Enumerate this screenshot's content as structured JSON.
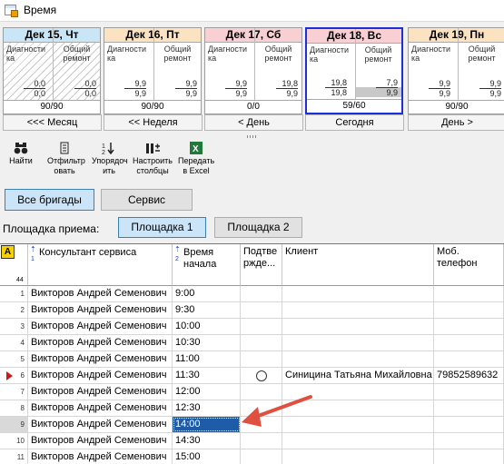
{
  "window": {
    "title": "Время"
  },
  "days": [
    {
      "header": "Дек 15, Чт",
      "color": "#c9e6f7",
      "col1": "Диагности ка",
      "col2": "Общий ремонт",
      "l1": "0,0",
      "l2": "0,0",
      "r1": "0,0",
      "r2": "0,0",
      "footer": "90/90",
      "hatched": true
    },
    {
      "header": "Дек 16, Пт",
      "color": "#fbe3c2",
      "col1": "Диагности ка",
      "col2": "Общий ремонт",
      "l1": "9,9",
      "l2": "9,9",
      "r1": "9,9",
      "r2": "9,9",
      "footer": "90/90",
      "hatched": false
    },
    {
      "header": "Дек 17, Сб",
      "color": "#f8cfd3",
      "col1": "Диагности ка",
      "col2": "Общий ремонт",
      "l1": "9,9",
      "l2": "9,9",
      "r1": "19,8",
      "r2": "9,9",
      "footer": "0/0",
      "hatched": false
    },
    {
      "header": "Дек 18, Вс",
      "color": "#f8cfd3",
      "col1": "Диагности ка",
      "col2": "Общий ремонт",
      "l1": "19,8",
      "l2": "19,8",
      "r1": "7,9",
      "r2": "9,9",
      "footer": "59/60",
      "hatched": false,
      "today": true
    },
    {
      "header": "Дек 19, Пн",
      "color": "#fbe3c2",
      "col1": "Диагности ка",
      "col2": "Общий ремонт",
      "l1": "9,9",
      "l2": "9,9",
      "r1": "9,9",
      "r2": "9,9",
      "footer": "90/90",
      "hatched": false
    }
  ],
  "nav": {
    "month": "<<< Месяц",
    "week": "<< Неделя",
    "day_prev": "< День",
    "today": "Сегодня",
    "day_next": "День >"
  },
  "toolbar": {
    "find": "Найти",
    "filter": "Отфильтр овать",
    "sort": "Упорядоч ить",
    "columns": "Настроить столбцы",
    "excel": "Передать в Excel"
  },
  "brigades": {
    "all": "Все бригады",
    "service": "Сервис"
  },
  "site": {
    "label": "Площадка приема:",
    "site1": "Площадка 1",
    "site2": "Площадка 2"
  },
  "grid": {
    "corner": "A",
    "corner_count": "44",
    "columns": {
      "consultant": "Консультант сервиса",
      "consultant_sort": "1",
      "time": "Время начала",
      "time_sort": "2",
      "confirmed": "Подтве ржде...",
      "client": "Клиент",
      "phone": "Моб. телефон"
    },
    "rows": [
      {
        "n": "1",
        "consultant": "Викторов Андрей Семенович",
        "time": "9:00",
        "client": "",
        "phone": ""
      },
      {
        "n": "2",
        "consultant": "Викторов Андрей Семенович",
        "time": "9:30",
        "client": "",
        "phone": ""
      },
      {
        "n": "3",
        "consultant": "Викторов Андрей Семенович",
        "time": "10:00",
        "client": "",
        "phone": ""
      },
      {
        "n": "4",
        "consultant": "Викторов Андрей Семенович",
        "time": "10:30",
        "client": "",
        "phone": ""
      },
      {
        "n": "5",
        "consultant": "Викторов Андрей Семенович",
        "time": "11:00",
        "client": "",
        "phone": ""
      },
      {
        "n": "6",
        "consultant": "Викторов Андрей Семенович",
        "time": "11:30",
        "client": "Синицина Татьяна Михайловна",
        "phone": "79852589632"
      },
      {
        "n": "7",
        "consultant": "Викторов Андрей Семенович",
        "time": "12:00",
        "client": "",
        "phone": ""
      },
      {
        "n": "8",
        "consultant": "Викторов Андрей Семенович",
        "time": "12:30",
        "client": "",
        "phone": ""
      },
      {
        "n": "9",
        "consultant": "Викторов Андрей Семенович",
        "time": "14:00",
        "client": "",
        "phone": ""
      },
      {
        "n": "10",
        "consultant": "Викторов Андрей Семенович",
        "time": "14:30",
        "client": "",
        "phone": ""
      },
      {
        "n": "11",
        "consultant": "Викторов Андрей Семенович",
        "time": "15:00",
        "client": "",
        "phone": ""
      }
    ]
  }
}
